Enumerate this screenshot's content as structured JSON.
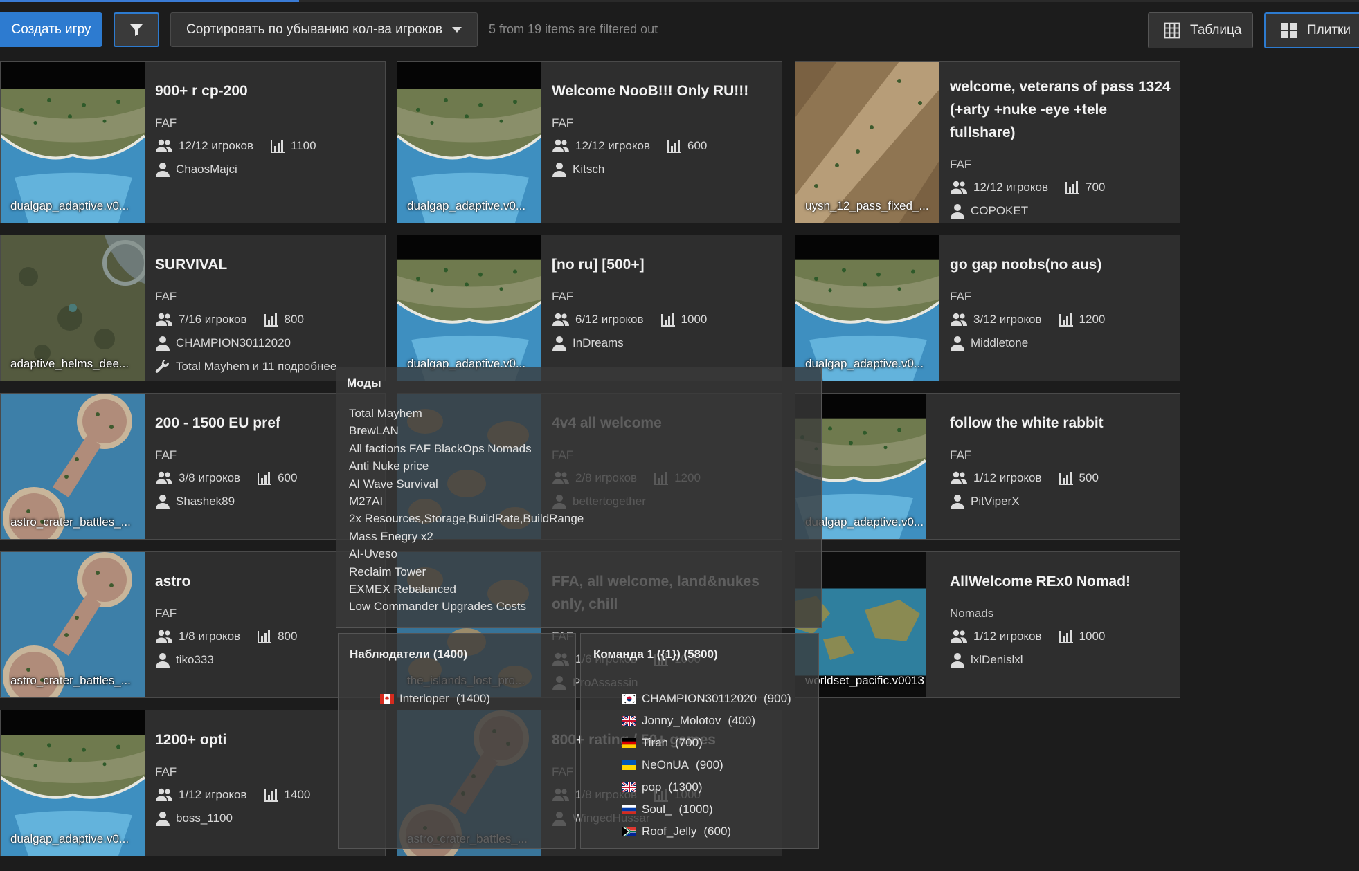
{
  "toolbar": {
    "create_label": "Создать игру",
    "sort_label": "Сортировать по убыванию кол-ва игроков",
    "filter_info": "5 from 19 items are filtered out",
    "view_table_label": "Таблица",
    "view_tiles_label": "Плитки"
  },
  "games": [
    {
      "title": "900+ r cp-200",
      "featured": "FAF",
      "players": "12/12 игроков",
      "rating": "1100",
      "host": "ChaosMajci",
      "map": "dualgap_adaptive.v0..."
    },
    {
      "title": "Welcome NooB!!! Only RU!!!",
      "featured": "FAF",
      "players": "12/12 игроков",
      "rating": "600",
      "host": "Kitsch",
      "map": "dualgap_adaptive.v0..."
    },
    {
      "title": "welcome, veterans of pass 1324 (+arty +nuke -eye +tele fullshare)",
      "featured": "FAF",
      "players": "12/12 игроков",
      "rating": "700",
      "host": "COPOKET",
      "map": "uysn_12_pass_fixed_..."
    },
    {
      "title": "SURVIVAL",
      "featured": "FAF",
      "players": "7/16 игроков",
      "rating": "800",
      "host": "CHAMPION30112020",
      "mods": "Total Mayhem и 11 подробнее",
      "map": "adaptive_helms_dee..."
    },
    {
      "title": "[no ru] [500+]",
      "featured": "FAF",
      "players": "6/12 игроков",
      "rating": "1000",
      "host": "InDreams",
      "map": "dualgap_adaptive.v0..."
    },
    {
      "title": "go gap noobs(no aus)",
      "featured": "FAF",
      "players": "3/12 игроков",
      "rating": "1200",
      "host": "Middletone",
      "map": "dualgap_adaptive.v0..."
    },
    {
      "title": "200 - 1500 EU pref",
      "featured": "FAF",
      "players": "3/8 игроков",
      "rating": "600",
      "host": "Shashek89",
      "map": "astro_crater_battles_..."
    },
    {
      "title": "4v4 all welcome",
      "featured": "FAF",
      "players": "2/8 игроков",
      "rating": "1200",
      "host": "bettertogether",
      "map": ""
    },
    {
      "title": "follow the white rabbit",
      "featured": "FAF",
      "players": "1/12 игроков",
      "rating": "500",
      "host": "PitViperX",
      "map": "dualgap_adaptive.v0..."
    },
    {
      "title": "astro",
      "featured": "FAF",
      "players": "1/8 игроков",
      "rating": "800",
      "host": "tiko333",
      "map": "astro_crater_battles_..."
    },
    {
      "title": "FFA, all welcome, land&nukes only, chill",
      "featured": "FAF",
      "players": "1/6 игроков",
      "rating": "1000",
      "host": "ProAssassin",
      "map": "the_islands_lost_pro..."
    },
    {
      "title": "AllWelcome REx0 Nomad!",
      "featured": "Nomads",
      "players": "1/12 игроков",
      "rating": "1000",
      "host": "lxlDenislxl",
      "map": "worldset_pacific.v0013"
    },
    {
      "title": "1200+ opti",
      "featured": "FAF",
      "players": "1/12 игроков",
      "rating": "1400",
      "host": "boss_1100",
      "map": "dualgap_adaptive.v0..."
    },
    {
      "title": "800+ rating / 50+ games",
      "featured": "FAF",
      "players": "1/8 игроков",
      "rating": "1000",
      "host": "WingedHussar",
      "map": "astro_crater_battles_..."
    }
  ],
  "mods_tooltip": {
    "title": "Моды",
    "items": [
      "Total Mayhem",
      "BrewLAN",
      "All factions FAF BlackOps Nomads",
      "Anti Nuke price",
      "AI Wave Survival",
      "M27AI",
      "2x Resources,Storage,BuildRate,BuildRange",
      "Mass Enegry x2",
      "AI-Uveso",
      "Reclaim Tower",
      "EXMEX Rebalanced",
      "Low Commander Upgrades Costs"
    ]
  },
  "observers_tooltip": {
    "title": "Наблюдатели (1400)",
    "players": [
      {
        "name": "Interloper",
        "rating": "(1400)",
        "flag": "ca"
      }
    ]
  },
  "team_tooltip": {
    "title": "Команда 1 ({1}) (5800)",
    "players": [
      {
        "name": "CHAMPION30112020",
        "rating": "(900)",
        "flag": "kr"
      },
      {
        "name": "Jonny_Molotov",
        "rating": "(400)",
        "flag": "gb"
      },
      {
        "name": "Tiran",
        "rating": "(700)",
        "flag": "de"
      },
      {
        "name": "NeOnUA",
        "rating": "(900)",
        "flag": "ua"
      },
      {
        "name": "pop",
        "rating": "(1300)",
        "flag": "gb"
      },
      {
        "name": "Soul_",
        "rating": "(1000)",
        "flag": "ru"
      },
      {
        "name": "Roof_Jelly",
        "rating": "(600)",
        "flag": "za"
      }
    ]
  },
  "colors": {
    "accent": "#2d7bd0",
    "background": "#1c1c1c",
    "card": "#2e2e2e"
  },
  "icons": {
    "players": "people-icon",
    "rating": "bar-chart-icon",
    "host": "person-icon",
    "mods": "wrench-icon",
    "filter": "filter-icon",
    "table": "grid-icon",
    "tiles": "tiles-icon"
  }
}
